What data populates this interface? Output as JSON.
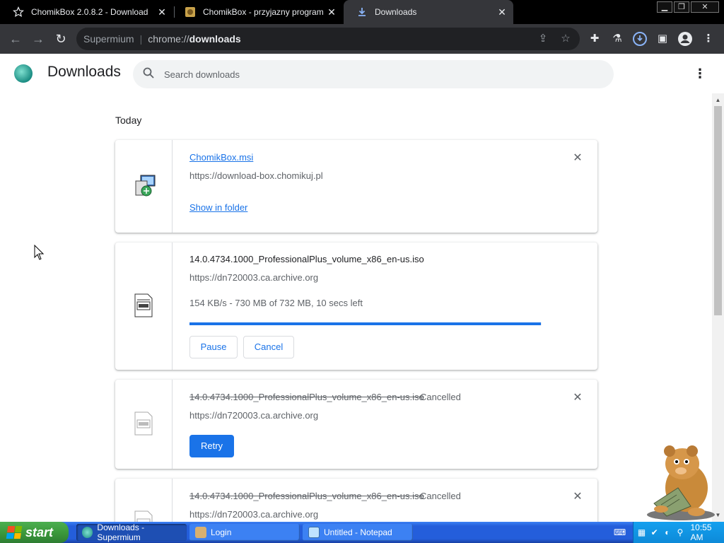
{
  "browser": {
    "tabs": [
      {
        "title": "ChomikBox 2.0.8.2 - Download",
        "icon": "star-icon",
        "active": false
      },
      {
        "title": "ChomikBox - przyjazny program ułat",
        "icon": "chomikbox-favicon",
        "active": false
      },
      {
        "title": "Downloads",
        "icon": "download-icon",
        "active": true
      }
    ],
    "omnibox": {
      "site_name": "Supermium",
      "url_prefix": "chrome://",
      "url_bold": "downloads"
    }
  },
  "downloads_page": {
    "title": "Downloads",
    "search_placeholder": "Search downloads",
    "date_header": "Today",
    "items": [
      {
        "filename": "ChomikBox.msi",
        "source": "https://download-box.chomikuj.pl",
        "action": "Show in folder",
        "state": "complete"
      },
      {
        "filename": "14.0.4734.1000_ProfessionalPlus_volume_x86_en-us.iso",
        "source": "https://dn720003.ca.archive.org",
        "progress_text": "154 KB/s - 730 MB of 732 MB, 10 secs left",
        "progress": 0.9973,
        "pause_label": "Pause",
        "cancel_label": "Cancel",
        "state": "in_progress"
      },
      {
        "filename": "14.0.4734.1000_ProfessionalPlus_volume_x86_en-us.iso",
        "status": "Cancelled",
        "source": "https://dn720003.ca.archive.org",
        "retry_label": "Retry",
        "state": "cancelled"
      },
      {
        "filename": "14.0.4734.1000_ProfessionalPlus_volume_x86_en-us.iso",
        "status": "Cancelled",
        "source": "https://dn720003.ca.archive.org",
        "state": "cancelled"
      }
    ]
  },
  "taskbar": {
    "start_label": "start",
    "tasks": [
      {
        "label": "Downloads - Supermium",
        "active": true
      },
      {
        "label": "Login",
        "active": false
      },
      {
        "label": "Untitled - Notepad",
        "active": false
      }
    ],
    "clock": "10:55 AM"
  },
  "colors": {
    "accent": "#1a73e8",
    "taskbar": "#245edb",
    "start": "#3c9a3c"
  }
}
